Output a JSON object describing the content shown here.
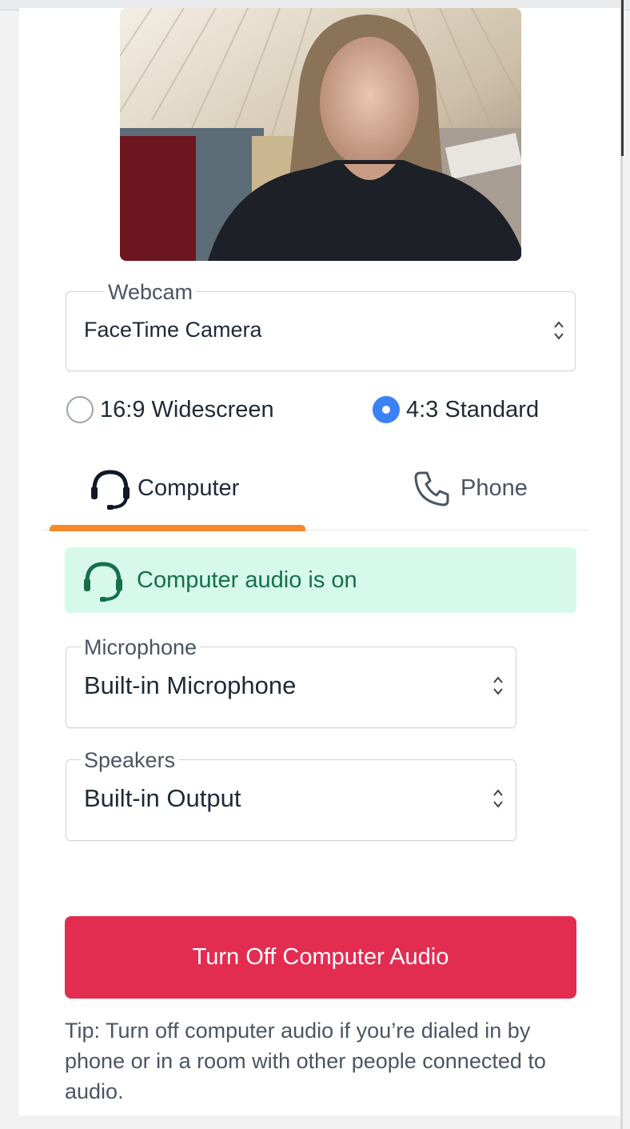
{
  "webcam": {
    "legend": "Webcam",
    "value": "FaceTime Camera"
  },
  "aspect": {
    "options": [
      {
        "label": "16:9 Widescreen",
        "selected": false
      },
      {
        "label": "4:3 Standard",
        "selected": true
      }
    ]
  },
  "tabs": [
    {
      "label": "Computer",
      "icon": "headset-icon",
      "active": true
    },
    {
      "label": "Phone",
      "icon": "phone-icon",
      "active": false
    }
  ],
  "status": {
    "text": "Computer audio is on",
    "icon": "headset-icon"
  },
  "microphone": {
    "legend": "Microphone",
    "value": "Built-in Microphone"
  },
  "speakers": {
    "legend": "Speakers",
    "value": "Built-in Output"
  },
  "action": {
    "label": "Turn Off Computer Audio"
  },
  "tip": "Tip: Turn off computer audio if you’re dialed in by phone or in a room with other people connected to audio.",
  "colors": {
    "accent_tab": "#f7872b",
    "radio_selected": "#3b82f6",
    "status_bg": "#d6f9ec",
    "status_text": "#15704a",
    "button": "#e22d51"
  }
}
